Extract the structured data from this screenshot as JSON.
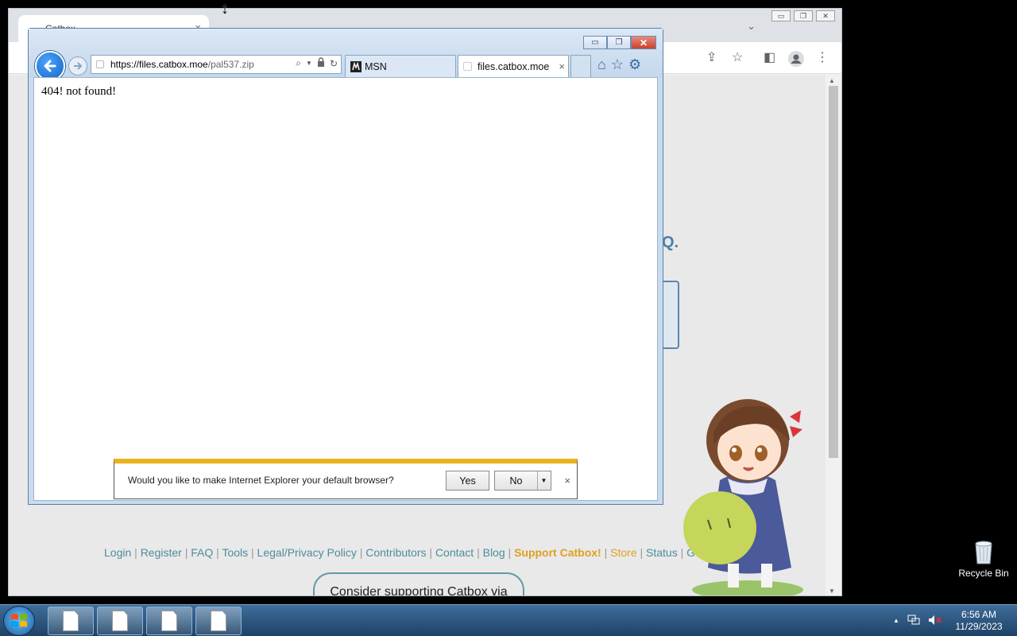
{
  "chrome": {
    "tab_title": "Catbox",
    "tab_close": "×",
    "tab_search_glyph": "⌄",
    "faq_fragment": "Q.",
    "footer": [
      {
        "text": "Login",
        "kind": "lnk"
      },
      {
        "text": " | ",
        "kind": "sep"
      },
      {
        "text": "Register",
        "kind": "lnk"
      },
      {
        "text": " | ",
        "kind": "sep"
      },
      {
        "text": "FAQ",
        "kind": "lnk"
      },
      {
        "text": " | ",
        "kind": "sep"
      },
      {
        "text": "Tools",
        "kind": "lnk"
      },
      {
        "text": " | ",
        "kind": "sep"
      },
      {
        "text": "Legal/Privacy Policy",
        "kind": "lnk"
      },
      {
        "text": " | ",
        "kind": "sep"
      },
      {
        "text": "Contributors",
        "kind": "lnk"
      },
      {
        "text": " | ",
        "kind": "sep"
      },
      {
        "text": "Contact",
        "kind": "lnk"
      },
      {
        "text": " | ",
        "kind": "sep"
      },
      {
        "text": "Blog",
        "kind": "lnk"
      },
      {
        "text": " | ",
        "kind": "sep"
      },
      {
        "text": "Support Catbox!",
        "kind": "sup"
      },
      {
        "text": " | ",
        "kind": "sep"
      },
      {
        "text": "Store",
        "kind": "store"
      },
      {
        "text": " | ",
        "kind": "sep"
      },
      {
        "text": "Status",
        "kind": "lnk"
      },
      {
        "text": " | ",
        "kind": "sep"
      },
      {
        "text": "Go Dark?",
        "kind": "lnk"
      }
    ],
    "consider_text": "Consider supporting Catbox via"
  },
  "ie": {
    "address_domain": "https://files.catbox.moe",
    "address_path": "/pal537.zip",
    "tabs": [
      {
        "label": "MSN",
        "active": false
      },
      {
        "label": "files.catbox.moe",
        "active": true
      }
    ],
    "tab_close": "×",
    "page_message": "404! not found!",
    "notification": {
      "text": "Would you like to make Internet Explorer your default browser?",
      "yes_label": "Yes",
      "no_label": "No",
      "close": "×"
    },
    "window_controls": {
      "minimize": "▭",
      "maximize": "❐",
      "close": "✕"
    }
  },
  "desktop": {
    "recycle_bin_label": "Recycle Bin"
  },
  "taskbar": {
    "time": "6:56 AM",
    "date": "11/29/2023",
    "items": [
      {
        "icon": "document-icon"
      },
      {
        "icon": "document-icon"
      },
      {
        "icon": "document-icon"
      },
      {
        "icon": "document-icon"
      }
    ],
    "tray_arrow": "▲"
  },
  "colors": {
    "ie_frame": "#c9dcef",
    "notification_bar": "#e8b31c",
    "catbox_link": "#4d8c9b",
    "catbox_support": "#e0a020",
    "taskbar": "#2d5580"
  }
}
